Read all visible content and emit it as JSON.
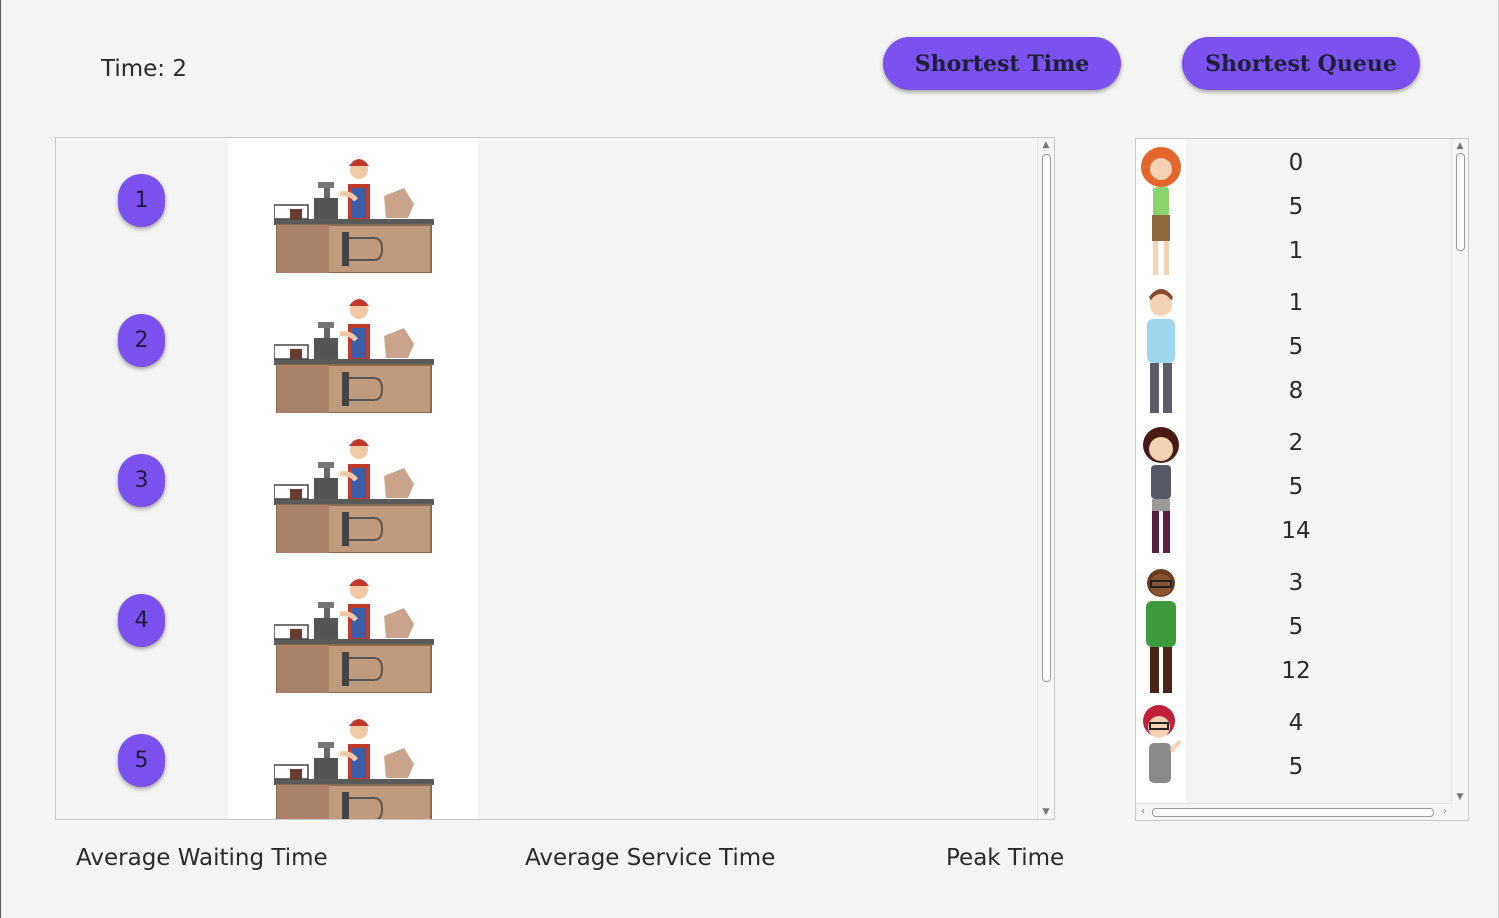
{
  "time": {
    "label": "Time: 2"
  },
  "buttons": {
    "shortest_time": "Shortest Time",
    "shortest_queue": "Shortest Queue"
  },
  "lanes": [
    "1",
    "2",
    "3",
    "4",
    "5"
  ],
  "customers": [
    {
      "avatar": "woman-red-hair-avatar",
      "values": [
        "0",
        "5",
        "1"
      ]
    },
    {
      "avatar": "man-blue-shirt-avatar",
      "values": [
        "1",
        "5",
        "8"
      ]
    },
    {
      "avatar": "woman-dark-hair-avatar",
      "values": [
        "2",
        "5",
        "14"
      ]
    },
    {
      "avatar": "man-green-sweater-avatar",
      "values": [
        "3",
        "5",
        "12"
      ]
    },
    {
      "avatar": "woman-glasses-avatar",
      "values": [
        "4",
        "5",
        ""
      ]
    }
  ],
  "stats": {
    "avg_waiting": "Average Waiting Time",
    "avg_service": "Average Service Time",
    "peak": "Peak Time"
  },
  "colors": {
    "accent": "#7b52f0",
    "background": "#f4f4f4"
  }
}
